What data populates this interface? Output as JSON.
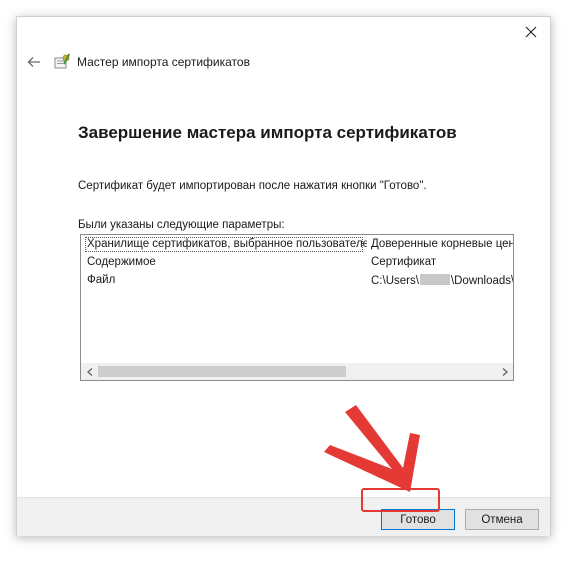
{
  "window": {
    "title": "Мастер импорта сертификатов"
  },
  "wizard": {
    "heading": "Завершение мастера импорта сертификатов",
    "info": "Сертификат будет импортирован после нажатия кнопки \"Готово\".",
    "params_label": "Были указаны следующие параметры:",
    "params": [
      {
        "name": "Хранилище сертификатов, выбранное пользователем",
        "value": "Доверенные корневые цент"
      },
      {
        "name": "Содержимое",
        "value": "Сертификат"
      },
      {
        "name": "Файл",
        "value_prefix": "C:\\Users\\",
        "value_suffix": "\\Downloads\\K"
      }
    ]
  },
  "footer": {
    "finish_label": "Готово",
    "cancel_label": "Отмена"
  },
  "colors": {
    "annotation": "#e53935",
    "accent": "#0078d7",
    "footer_bg": "#f0f0f0"
  },
  "icons": {
    "close": "close-icon",
    "back": "back-arrow-icon",
    "app": "certificate-icon",
    "scroll_left": "scroll-left-icon",
    "scroll_right": "scroll-right-icon"
  }
}
